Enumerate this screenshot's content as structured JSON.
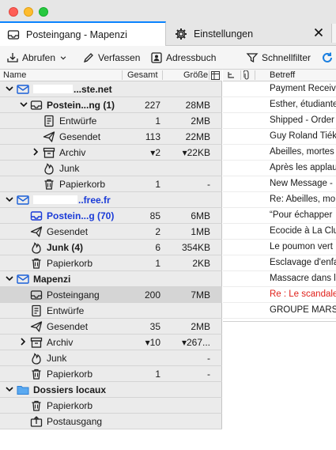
{
  "window": {
    "tabs": [
      {
        "label": "Posteingang - Mapenzi",
        "icon": "inbox-icon",
        "active": true
      },
      {
        "label": "Einstellungen",
        "icon": "gear-icon",
        "active": false
      }
    ],
    "close_label": "✕"
  },
  "toolbar": {
    "get_messages": "Abrufen",
    "write": "Verfassen",
    "address_book": "Adressbuch",
    "quick_filter": "Schnellfilter"
  },
  "folder_pane": {
    "columns": {
      "name": "Name",
      "total": "Gesamt",
      "size": "Größe"
    },
    "rows": [
      {
        "name": "...ste.net",
        "total": "",
        "size": "",
        "redacted": true
      },
      {
        "name": "Postein...ng (1)",
        "total": "227",
        "size": "28MB"
      },
      {
        "name": "Entwürfe",
        "total": "1",
        "size": "2MB"
      },
      {
        "name": "Gesendet",
        "total": "113",
        "size": "22MB"
      },
      {
        "name": "Archiv",
        "total": "▾2",
        "size": "▾22KB"
      },
      {
        "name": "Junk",
        "total": "",
        "size": ""
      },
      {
        "name": "Papierkorb",
        "total": "1",
        "size": "-"
      },
      {
        "name": "..free.fr",
        "total": "",
        "size": "",
        "redacted": true
      },
      {
        "name": "Postein...g (70)",
        "total": "85",
        "size": "6MB"
      },
      {
        "name": "Gesendet",
        "total": "2",
        "size": "1MB"
      },
      {
        "name": "Junk (4)",
        "total": "6",
        "size": "354KB"
      },
      {
        "name": "Papierkorb",
        "total": "1",
        "size": "2KB"
      },
      {
        "name": "Mapenzi",
        "total": "",
        "size": ""
      },
      {
        "name": "Posteingang",
        "total": "200",
        "size": "7MB"
      },
      {
        "name": "Entwürfe",
        "total": "",
        "size": ""
      },
      {
        "name": "Gesendet",
        "total": "35",
        "size": "2MB"
      },
      {
        "name": "Archiv",
        "total": "▾10",
        "size": "▾267..."
      },
      {
        "name": "Junk",
        "total": "",
        "size": "-"
      },
      {
        "name": "Papierkorb",
        "total": "1",
        "size": "-"
      },
      {
        "name": "Dossiers locaux",
        "total": "",
        "size": ""
      },
      {
        "name": "Papierkorb",
        "total": "",
        "size": ""
      },
      {
        "name": "Postausgang",
        "total": "",
        "size": ""
      }
    ]
  },
  "thread_pane": {
    "columns": {
      "subject": "Betreff"
    },
    "rows": [
      {
        "subject": "Payment Receive"
      },
      {
        "subject": "Esther, étudiante"
      },
      {
        "subject": "Shipped - Order"
      },
      {
        "subject": "Guy Roland Tiék"
      },
      {
        "subject": "Abeilles, mortes"
      },
      {
        "subject": "Après les applau"
      },
      {
        "subject": "New Message -"
      },
      {
        "subject": "Re: Abeilles, mo"
      },
      {
        "subject": "“Pour échapper"
      },
      {
        "subject": "Ecocide à La Clu"
      },
      {
        "subject": "Le poumon vert"
      },
      {
        "subject": "Esclavage d'enfa"
      },
      {
        "subject": "Massacre dans l"
      },
      {
        "subject": "Re : Le scandale",
        "color": "#e0201a"
      },
      {
        "subject": "GROUPE MARS"
      }
    ]
  }
}
